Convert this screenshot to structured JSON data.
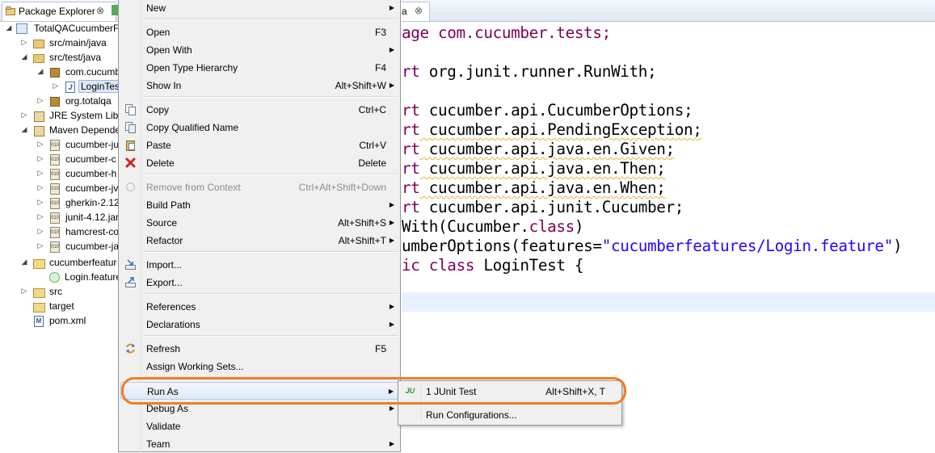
{
  "explorer": {
    "tab_title": "Package Explorer",
    "tab_close": "⊗",
    "tree": [
      {
        "label": "TotalQACucumberF",
        "icon": "maven-project-icon",
        "twisty": "◢"
      },
      {
        "label": "src/main/java",
        "icon": "source-folder-icon",
        "twisty": "▷"
      },
      {
        "label": "src/test/java",
        "icon": "source-folder-icon",
        "twisty": "◢"
      },
      {
        "label": "com.cucumb",
        "icon": "package-icon",
        "twisty": "◢"
      },
      {
        "label": "LoginTes",
        "icon": "java-file-icon",
        "twisty": "▷"
      },
      {
        "label": "org.totalqa",
        "icon": "package-icon",
        "twisty": "▷"
      },
      {
        "label": "JRE System Libra",
        "icon": "library-icon",
        "twisty": "▷"
      },
      {
        "label": "Maven Depende",
        "icon": "library-icon",
        "twisty": "◢"
      },
      {
        "label": "cucumber-ju",
        "icon": "jar-icon",
        "twisty": "▷"
      },
      {
        "label": "cucumber-c",
        "icon": "jar-icon",
        "twisty": "▷"
      },
      {
        "label": "cucumber-h",
        "icon": "jar-icon",
        "twisty": "▷"
      },
      {
        "label": "cucumber-jv",
        "icon": "jar-icon",
        "twisty": "▷"
      },
      {
        "label": "gherkin-2.12",
        "icon": "jar-icon",
        "twisty": "▷"
      },
      {
        "label": "junit-4.12.jar",
        "icon": "jar-icon",
        "twisty": "▷"
      },
      {
        "label": "hamcrest-co",
        "icon": "jar-icon",
        "twisty": "▷"
      },
      {
        "label": "cucumber-ja",
        "icon": "jar-icon",
        "twisty": "▷"
      },
      {
        "label": "cucumberfeatur",
        "icon": "folder-icon",
        "twisty": "◢"
      },
      {
        "label": "Login.feature",
        "icon": "feature-file-icon",
        "twisty": ""
      },
      {
        "label": "src",
        "icon": "folder-icon",
        "twisty": "▷"
      },
      {
        "label": "target",
        "icon": "folder-icon",
        "twisty": ""
      },
      {
        "label": "pom.xml",
        "icon": "pom-file-icon",
        "twisty": ""
      }
    ]
  },
  "editor": {
    "tab_title_fragment": "a",
    "tab_close": "⊗",
    "code": {
      "line1": "age com.cucumber.tests;",
      "line2_kw": "rt",
      "line2_rest": " org.junit.runner.RunWith;",
      "line3_kw": "rt",
      "line3_rest": " cucumber.api.CucumberOptions;",
      "line4_kw": "rt",
      "line4_rest": " cucumber.api.PendingException;",
      "line5_kw": "rt",
      "line5_rest": " cucumber.api.java.en.Given;",
      "line6_kw": "rt",
      "line6_rest": " cucumber.api.java.en.Then;",
      "line7_kw": "rt",
      "line7_rest": " cucumber.api.java.en.When;",
      "line8_kw": "rt",
      "line8_rest": " cucumber.api.junit.Cucumber;",
      "line9_a": "With(Cucumber.",
      "line9_kw": "class",
      "line9_b": ")",
      "line10_a": "umberOptions(features=",
      "line10_str": "\"cucumberfeatures/Login.feature\"",
      "line10_b": ")",
      "line11_kw1": "ic",
      "line11_kw2": " class",
      "line11_rest": " LoginTest {"
    }
  },
  "context_menu": {
    "items": [
      {
        "label": "New",
        "accel": "",
        "submenu": true
      },
      {
        "label": "Open",
        "accel": "F3"
      },
      {
        "label": "Open With",
        "accel": "",
        "submenu": true
      },
      {
        "label": "Open Type Hierarchy",
        "accel": "F4"
      },
      {
        "label": "Show In",
        "accel": "Alt+Shift+W",
        "submenu": true
      },
      {
        "label": "Copy",
        "accel": "Ctrl+C"
      },
      {
        "label": "Copy Qualified Name",
        "accel": ""
      },
      {
        "label": "Paste",
        "accel": "Ctrl+V"
      },
      {
        "label": "Delete",
        "accel": "Delete"
      },
      {
        "label": "Remove from Context",
        "accel": "Ctrl+Alt+Shift+Down",
        "disabled": true
      },
      {
        "label": "Build Path",
        "accel": "",
        "submenu": true
      },
      {
        "label": "Source",
        "accel": "Alt+Shift+S",
        "submenu": true
      },
      {
        "label": "Refactor",
        "accel": "Alt+Shift+T",
        "submenu": true
      },
      {
        "label": "Import...",
        "accel": ""
      },
      {
        "label": "Export...",
        "accel": ""
      },
      {
        "label": "References",
        "accel": "",
        "submenu": true
      },
      {
        "label": "Declarations",
        "accel": "",
        "submenu": true
      },
      {
        "label": "Refresh",
        "accel": "F5"
      },
      {
        "label": "Assign Working Sets...",
        "accel": ""
      },
      {
        "label": "Run As",
        "accel": "",
        "submenu": true,
        "highlighted": true
      },
      {
        "label": "Debug As",
        "accel": "",
        "submenu": true
      },
      {
        "label": "Validate",
        "accel": ""
      },
      {
        "label": "Team",
        "accel": "",
        "submenu": true
      }
    ],
    "arrow_glyph": "▶"
  },
  "run_as_submenu": {
    "items": [
      {
        "label": "1 JUnit Test",
        "accel": "Alt+Shift+X, T",
        "icon_text": "JU"
      },
      {
        "label": "Run Configurations...",
        "accel": ""
      }
    ]
  },
  "colors": {
    "highlight_ring": "#f07d24",
    "keyword": "#7f0055",
    "string": "#2a00ff"
  }
}
